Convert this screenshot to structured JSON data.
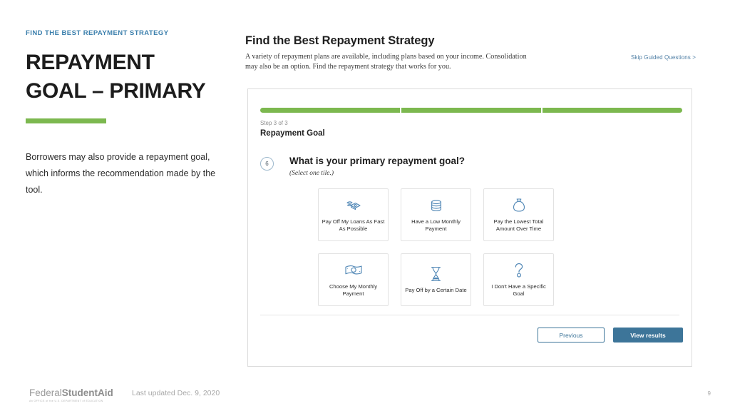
{
  "slide": {
    "eyebrow": "FIND THE BEST REPAYMENT STRATEGY",
    "title_line1": "REPAYMENT",
    "title_line2": "GOAL – PRIMARY",
    "body": "Borrowers may also provide a repayment goal, which informs the recommendation made by the tool.",
    "accent_color": "#7cb84f",
    "eyebrow_color": "#3d80ad"
  },
  "panel": {
    "title": "Find the Best Repayment Strategy",
    "subtitle": "A variety of repayment plans are available, including plans based on your income. Consolidation may also be an option. Find the repayment strategy that works for you.",
    "skip_link": "Skip Guided Questions >"
  },
  "wizard": {
    "progress": {
      "segments": 3,
      "completed": 3,
      "fill_color": "#7cb84f"
    },
    "step_label": "Step 3 of 3",
    "step_name": "Repayment Goal",
    "question_number": "6",
    "question": "What is your primary repayment goal?",
    "hint": "(Select one tile.)",
    "tiles": [
      {
        "icon": "flying-money-icon",
        "label": "Pay Off My Loans As Fast As Possible"
      },
      {
        "icon": "coin-stack-icon",
        "label": "Have a Low Monthly Payment"
      },
      {
        "icon": "money-bag-icon",
        "label": "Pay the Lowest Total Amount Over Time"
      },
      {
        "icon": "banknote-icon",
        "label": "Choose My Monthly Payment"
      },
      {
        "icon": "hourglass-icon",
        "label": "Pay Off by a Certain Date"
      },
      {
        "icon": "question-mark-icon",
        "label": "I Don't Have a Specific Goal"
      }
    ],
    "buttons": {
      "previous": "Previous",
      "view_results": "View results",
      "primary_color": "#3d7599"
    }
  },
  "footer": {
    "logo_first": "Federal",
    "logo_second": "StudentAid",
    "logo_tagline": "An OFFICE of the U.S. DEPARTMENT of EDUCATION",
    "last_updated": "Last updated Dec. 9, 2020",
    "page_number": "9"
  }
}
